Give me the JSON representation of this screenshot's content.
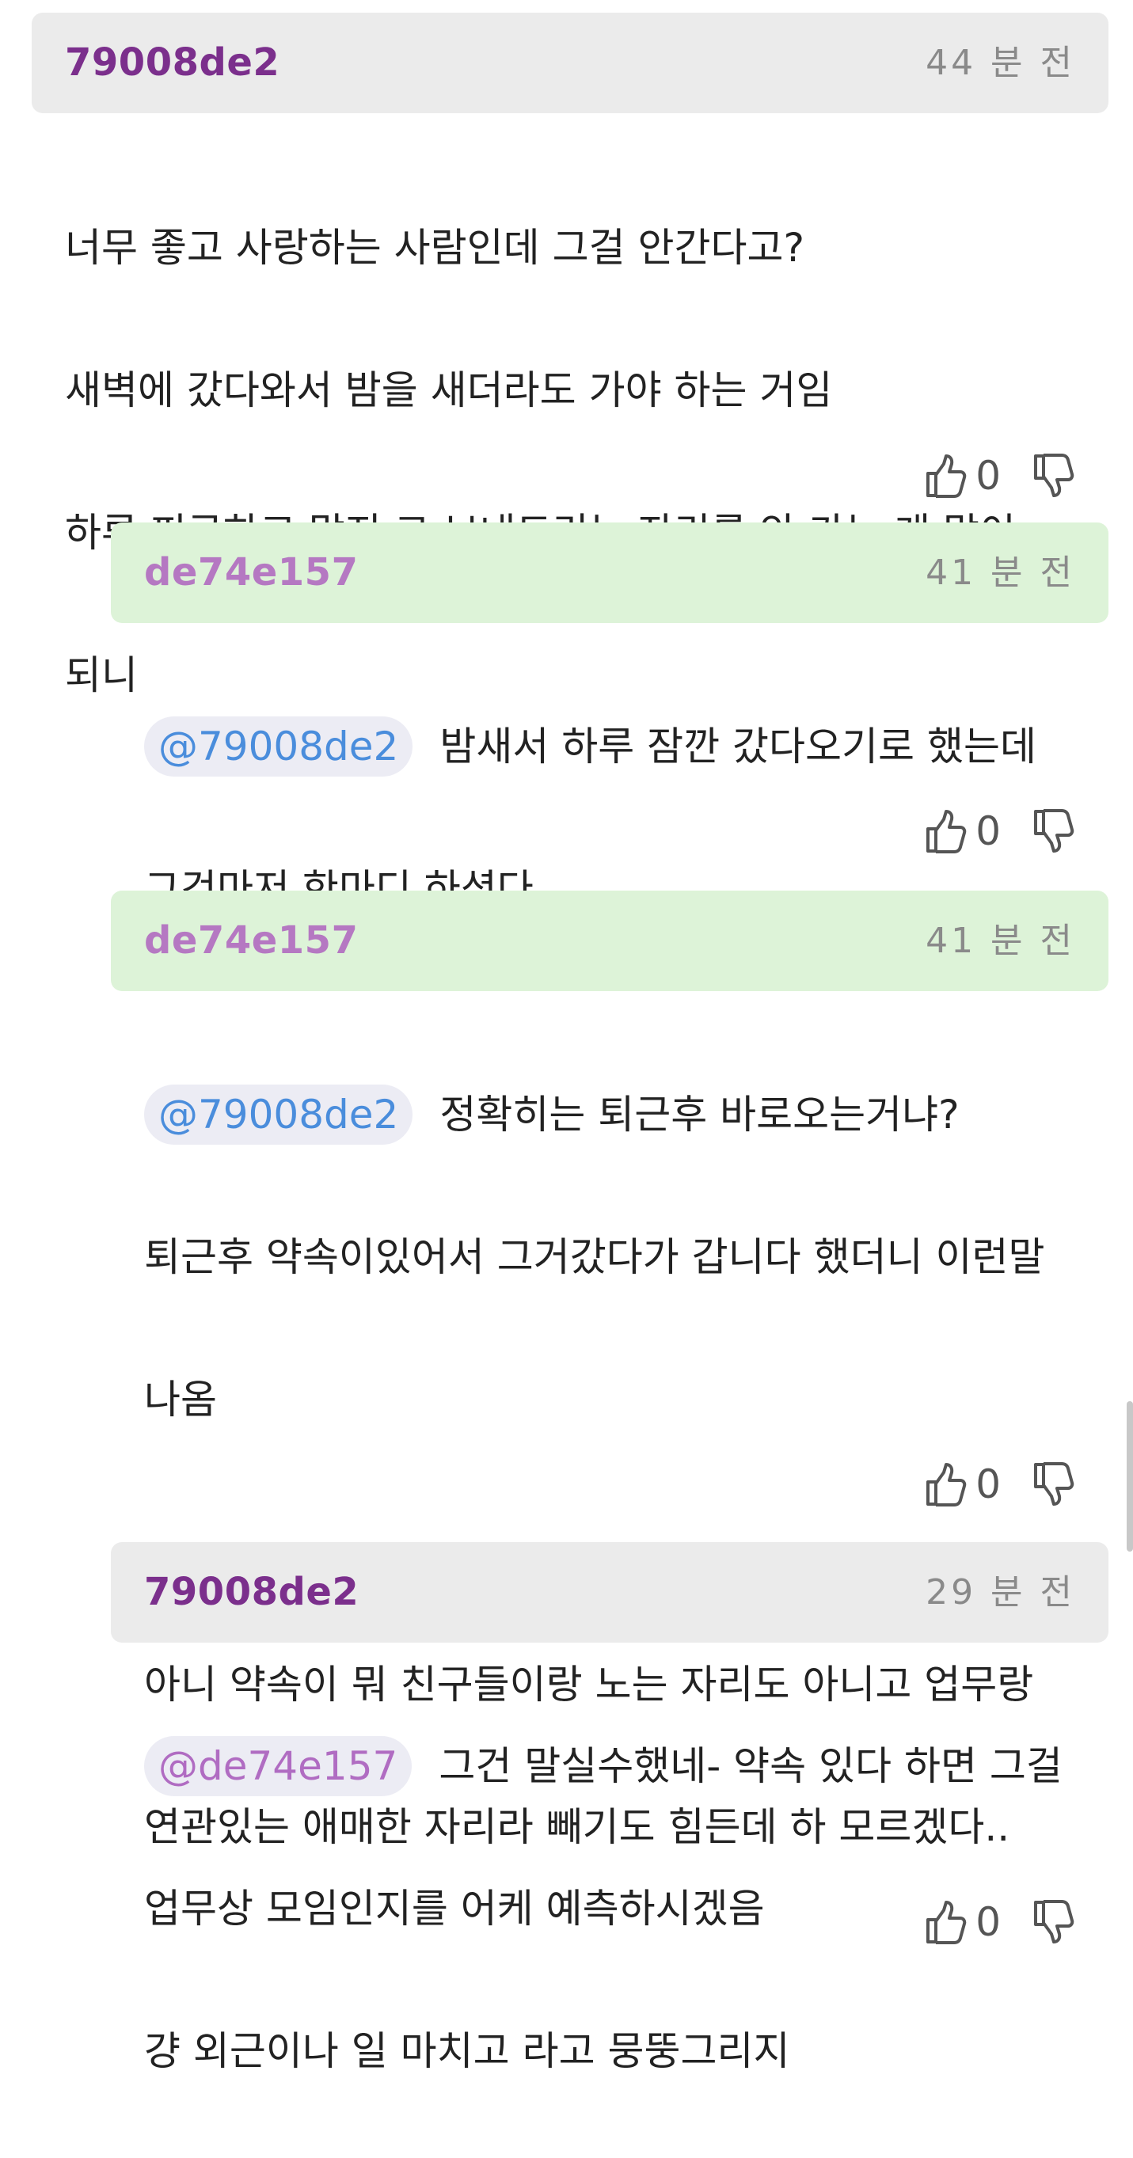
{
  "comments": [
    {
      "author": "79008de2",
      "time": "44 분 전",
      "mention": "",
      "lines": [
        "너무 좋고 사랑하는 사람인데 그걸 안간다고?",
        "새벽에 갔다와서 밤을 새더라도 가야 하는 거임",
        "하루 피곤하고 말지 그 보내드리는 자리를 안 가는 게 말이",
        "되니"
      ],
      "likes": "0"
    },
    {
      "author": "de74e157",
      "time": "41 분 전",
      "mention": "@79008de2",
      "lines": [
        "밤새서 하루 잠깐 갔다오기로 했는데",
        "그것마저 한마디 하셨다.."
      ],
      "likes": "0"
    },
    {
      "author": "de74e157",
      "time": "41 분 전",
      "mention": "@79008de2",
      "lines": [
        "정확히는 퇴근후 바로오는거냐?",
        "퇴근후 약속이있어서 그거갔다가 갑니다 했더니 이런말",
        "나옴",
        "",
        "아니 약속이 뭐 친구들이랑 노는 자리도 아니고 업무랑",
        "연관있는 애매한 자리라 빼기도 힘든데 하 모르겠다.."
      ],
      "likes": "0"
    },
    {
      "author": "79008de2",
      "time": "29 분 전",
      "mention": "@de74e157",
      "lines": [
        "그건 말실수했네- 약속 있다 하면 그걸",
        "업무상 모임인지를 어케 예측하시겠음",
        "걍 외근이나 일 마치고 라고 뭉뚱그리지"
      ],
      "likes": "0"
    }
  ],
  "icons": {
    "like": "thumbs-up-icon",
    "dislike": "thumbs-down-icon"
  },
  "colors": {
    "author_dark": "#7b2f8c",
    "author_light": "#b578c2",
    "header_gray": "#ebebeb",
    "header_green": "#ddf3d8",
    "mention_blue": "#4a8ddc"
  }
}
